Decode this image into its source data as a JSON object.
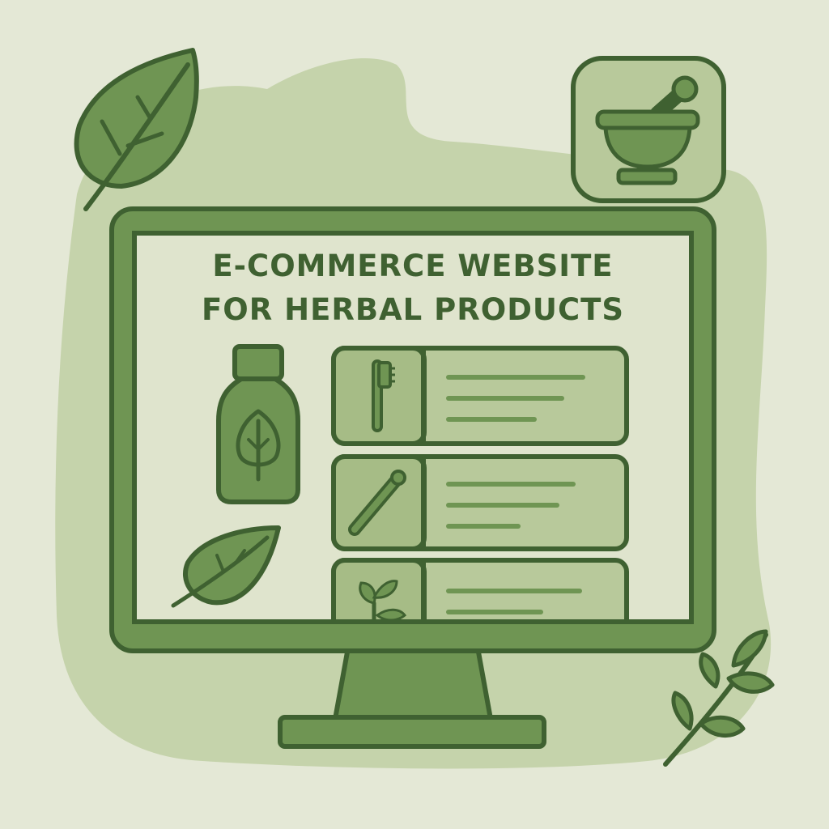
{
  "title": {
    "line1": "E-COMMERCE WEBSITE",
    "line2": "FOR HERBAL PRODUCTS"
  },
  "product_list": [
    {
      "icon": "toothbrush-icon",
      "text_lines": 3
    },
    {
      "icon": "herbal-stick-icon",
      "text_lines": 3
    },
    {
      "icon": "sprout-icon",
      "text_lines": 2
    }
  ],
  "icons": [
    "leaf-icon",
    "mortar-pestle-icon",
    "herbal-bottle-icon",
    "leaf-icon",
    "herb-sprig-icon"
  ],
  "colors": {
    "background": "#e4e8d6",
    "blob": "#c5d3ab",
    "outline": "#3f6131",
    "fill_mid": "#6f9553",
    "fill_light": "#b8c99b",
    "screen": "#dfe4cd"
  }
}
